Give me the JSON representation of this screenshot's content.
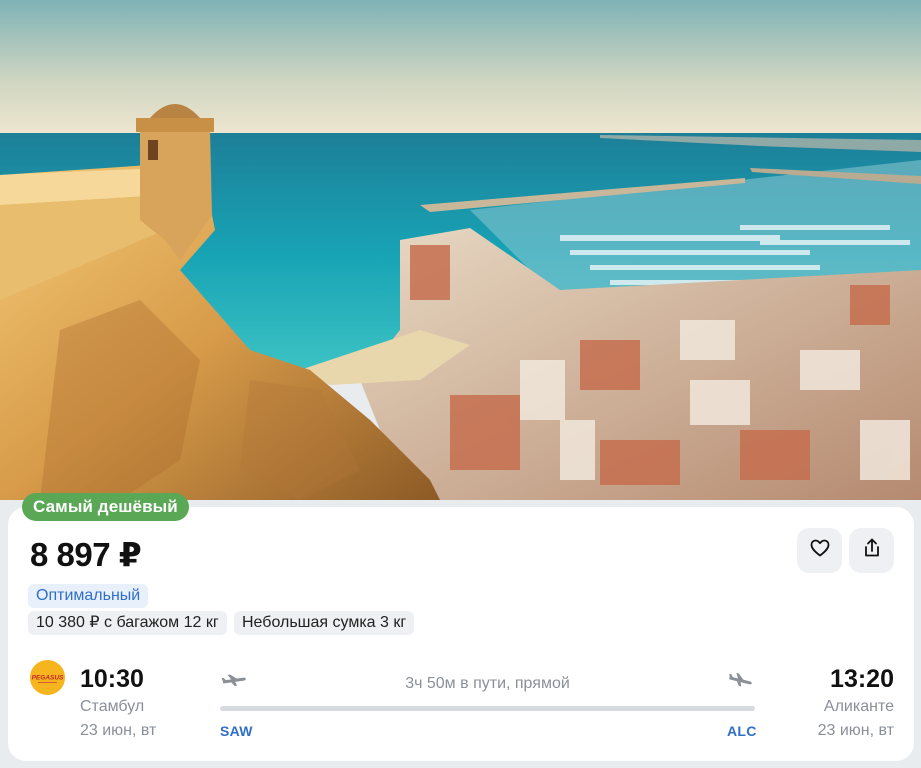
{
  "hero": {
    "icon": "alicante-coast-photo"
  },
  "badge": {
    "label": "Самый дешёвый"
  },
  "offer": {
    "price": "8 897 ₽",
    "tariff": "Оптимальный",
    "options": [
      {
        "label": "10 380 ₽ с багажом 12 кг"
      },
      {
        "label": "Небольшая сумка 3 кг"
      }
    ],
    "actions": {
      "favorite_icon": "heart-icon",
      "share_icon": "share-icon"
    }
  },
  "flight": {
    "airline_icon": "pegasus-logo",
    "airline_logo_text": "PEGASUS",
    "departure": {
      "time": "10:30",
      "city": "Стамбул",
      "date": "23 июн, вт",
      "code": "SAW"
    },
    "arrival": {
      "time": "13:20",
      "city": "Аликанте",
      "date": "23 июн, вт",
      "code": "ALC"
    },
    "duration": "3ч 50м в пути, прямой"
  },
  "colors": {
    "accent_green": "#5aa856",
    "accent_blue": "#2f6ec9",
    "muted_text": "#8a8f98"
  }
}
